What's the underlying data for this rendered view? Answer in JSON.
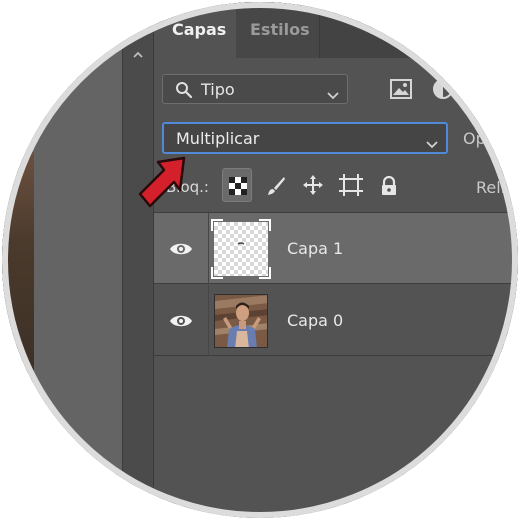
{
  "tabs": [
    {
      "label": "Capas",
      "active": true
    },
    {
      "label": "Estilos",
      "active": false
    }
  ],
  "filter": {
    "value": "Tipo"
  },
  "blend_mode": {
    "value": "Multiplicar"
  },
  "opacity_label": "Op",
  "lock_label": "Bloq.:",
  "fill_label": "Rell",
  "layers": [
    {
      "name": "Capa 1",
      "visible": true,
      "selected": true,
      "thumbnail": "transparent"
    },
    {
      "name": "Capa 0",
      "visible": true,
      "selected": false,
      "thumbnail": "photo"
    }
  ],
  "colors": {
    "panel_bg": "#535353",
    "selected_row": "#6a6a6a",
    "focus_border": "#4f89d8",
    "annotation_arrow": "#d4202a"
  },
  "icons": [
    "chevron-up-icon",
    "search-icon",
    "chevron-down-icon",
    "image-filter-icon",
    "adjustment-filter-icon",
    "lock-transparent-icon",
    "brush-icon",
    "move-icon",
    "artboard-icon",
    "lock-icon",
    "eye-icon",
    "red-arrow-annotation"
  ]
}
